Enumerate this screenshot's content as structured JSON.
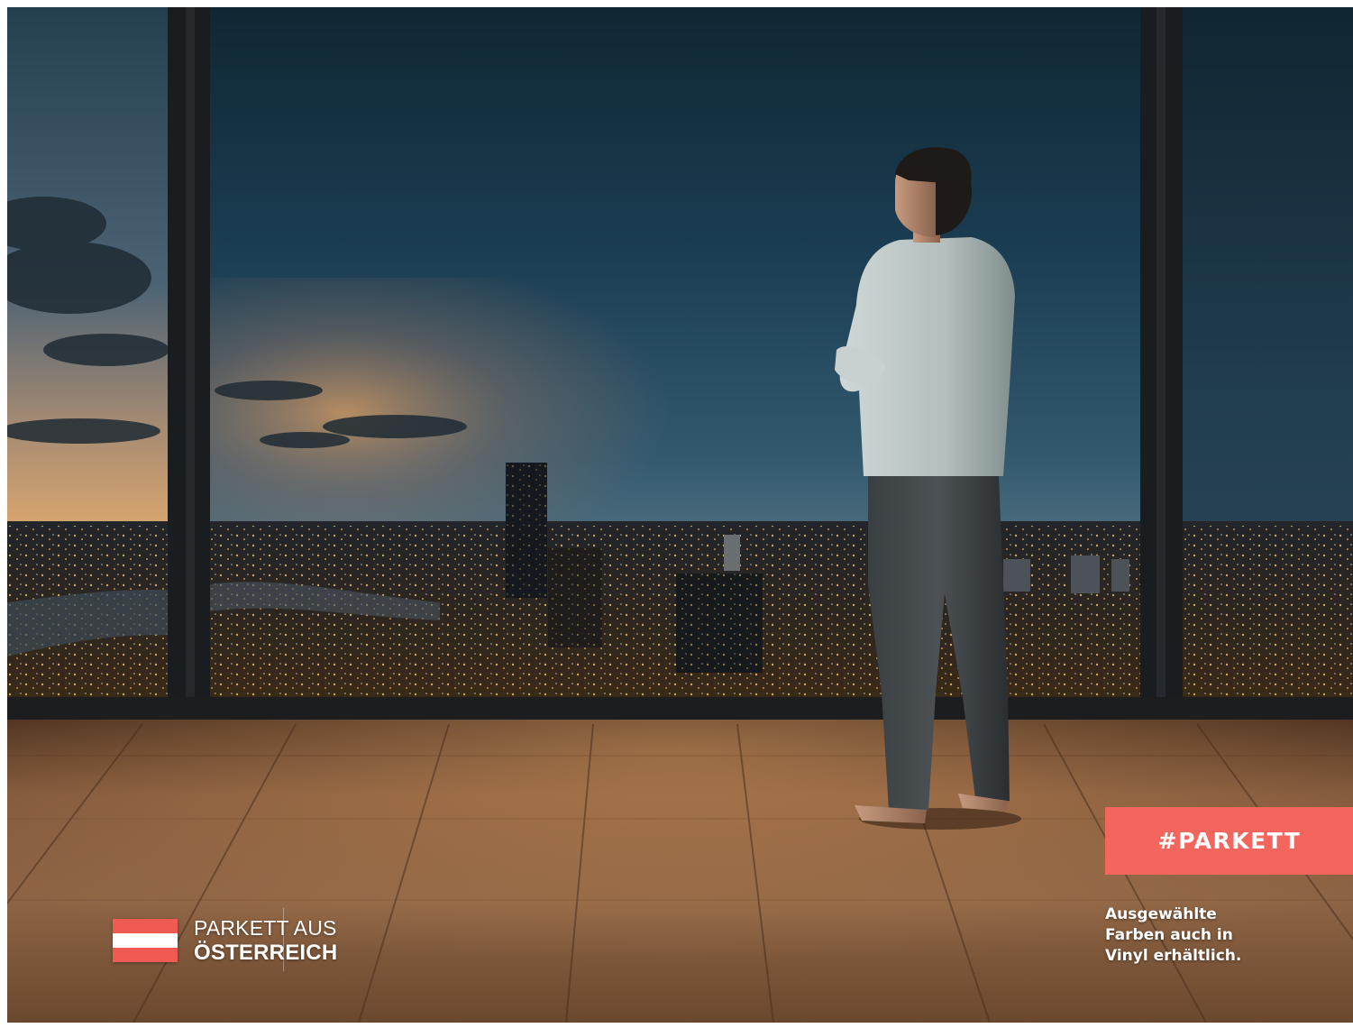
{
  "photo": {
    "subject": "man-looking-at-night-city-skyline",
    "floor": "oak-parquet"
  },
  "flag": {
    "icon": "austrian-flag-icon",
    "colors": [
      "#ef5b52",
      "#ffffff",
      "#ef5b52"
    ],
    "line1": "PARKETT AUS",
    "line2": "ÖSTERREICH"
  },
  "badge": {
    "text": "#PARKETT",
    "color": "#f4665d"
  },
  "note": {
    "lines": [
      "Ausgewählte",
      "Farben auch in",
      "Vinyl erhältlich."
    ]
  }
}
